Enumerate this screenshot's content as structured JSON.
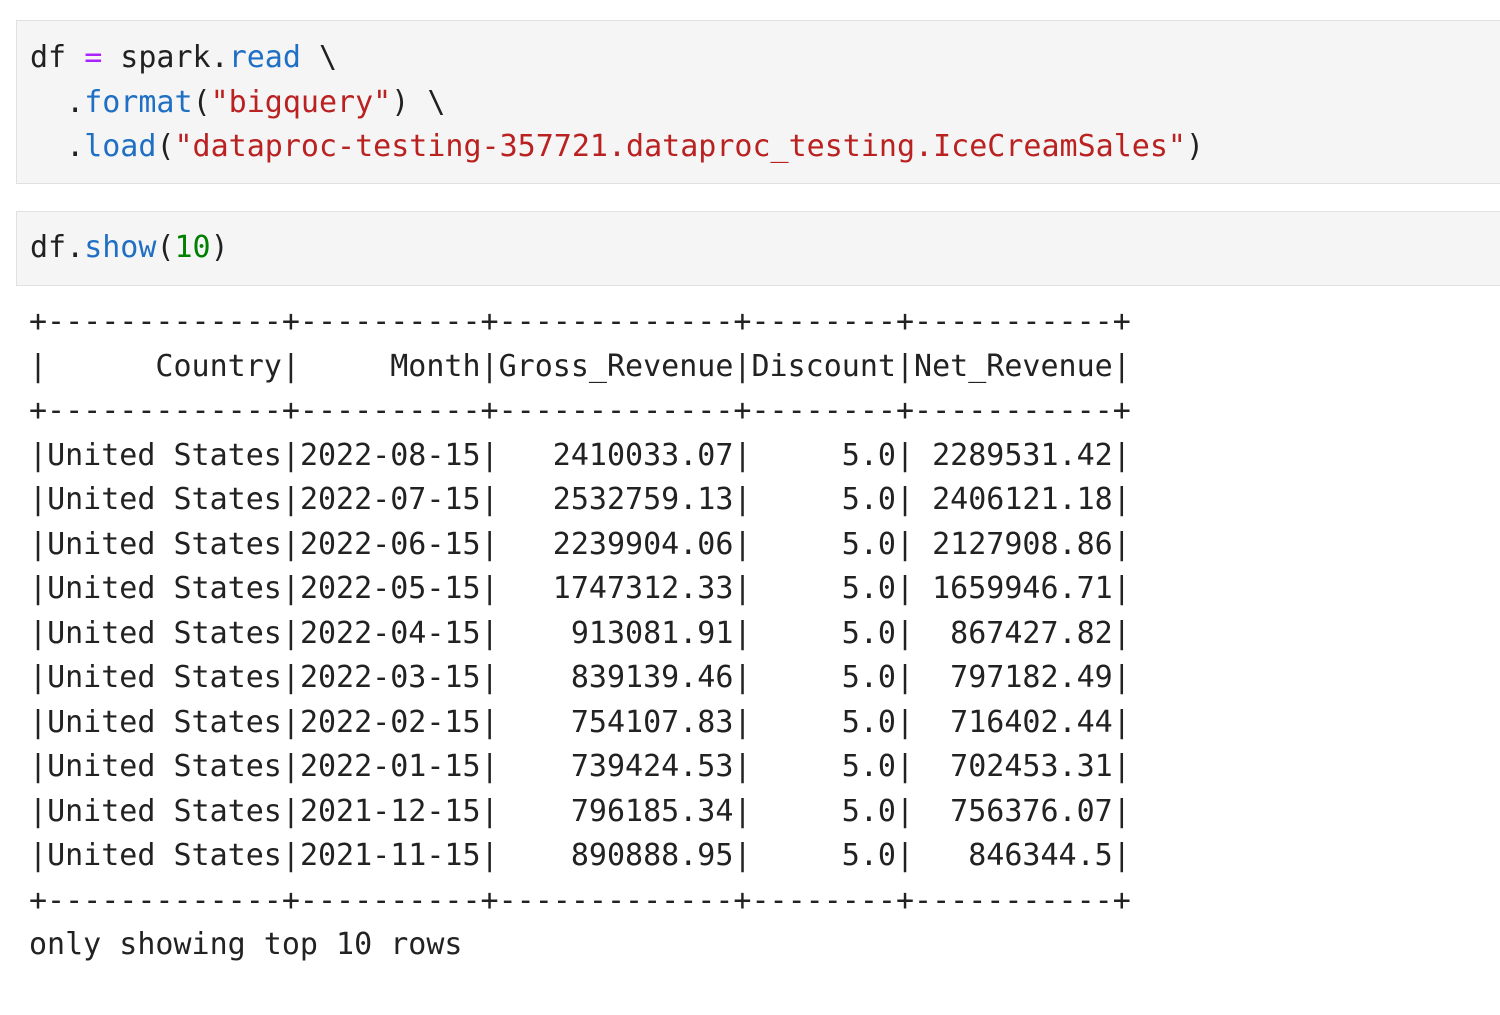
{
  "cells": [
    {
      "lines": [
        [
          {
            "t": "df ",
            "c": "plain"
          },
          {
            "t": "=",
            "c": "op"
          },
          {
            "t": " spark.",
            "c": "plain"
          },
          {
            "t": "read",
            "c": "attr"
          },
          {
            "t": " \\",
            "c": "plain"
          }
        ],
        [
          {
            "t": "  .",
            "c": "plain"
          },
          {
            "t": "format",
            "c": "attr"
          },
          {
            "t": "(",
            "c": "plain"
          },
          {
            "t": "\"bigquery\"",
            "c": "str"
          },
          {
            "t": ") \\",
            "c": "plain"
          }
        ],
        [
          {
            "t": "  .",
            "c": "plain"
          },
          {
            "t": "load",
            "c": "attr"
          },
          {
            "t": "(",
            "c": "plain"
          },
          {
            "t": "\"dataproc-testing-357721.dataproc_testing.IceCreamSales\"",
            "c": "str"
          },
          {
            "t": ")",
            "c": "plain"
          }
        ]
      ]
    },
    {
      "lines": [
        [
          {
            "t": "df.",
            "c": "plain"
          },
          {
            "t": "show",
            "c": "attr"
          },
          {
            "t": "(",
            "c": "plain"
          },
          {
            "t": "10",
            "c": "num"
          },
          {
            "t": ")",
            "c": "plain"
          }
        ]
      ]
    }
  ],
  "output": {
    "border": "+-------------+----------+-------------+--------+-----------+",
    "header_line": "|      Country|     Month|Gross_Revenue|Discount|Net_Revenue|",
    "table": {
      "columns": [
        "Country",
        "Month",
        "Gross_Revenue",
        "Discount",
        "Net_Revenue"
      ],
      "rows": [
        [
          "United States",
          "2022-08-15",
          "2410033.07",
          "5.0",
          "2289531.42"
        ],
        [
          "United States",
          "2022-07-15",
          "2532759.13",
          "5.0",
          "2406121.18"
        ],
        [
          "United States",
          "2022-06-15",
          "2239904.06",
          "5.0",
          "2127908.86"
        ],
        [
          "United States",
          "2022-05-15",
          "1747312.33",
          "5.0",
          "1659946.71"
        ],
        [
          "United States",
          "2022-04-15",
          "913081.91",
          "5.0",
          "867427.82"
        ],
        [
          "United States",
          "2022-03-15",
          "839139.46",
          "5.0",
          "797182.49"
        ],
        [
          "United States",
          "2022-02-15",
          "754107.83",
          "5.0",
          "716402.44"
        ],
        [
          "United States",
          "2022-01-15",
          "739424.53",
          "5.0",
          "702453.31"
        ],
        [
          "United States",
          "2021-12-15",
          "796185.34",
          "5.0",
          "756376.07"
        ],
        [
          "United States",
          "2021-11-15",
          "890888.95",
          "5.0",
          "846344.5"
        ]
      ]
    },
    "footer": "only showing top 10 rows"
  }
}
